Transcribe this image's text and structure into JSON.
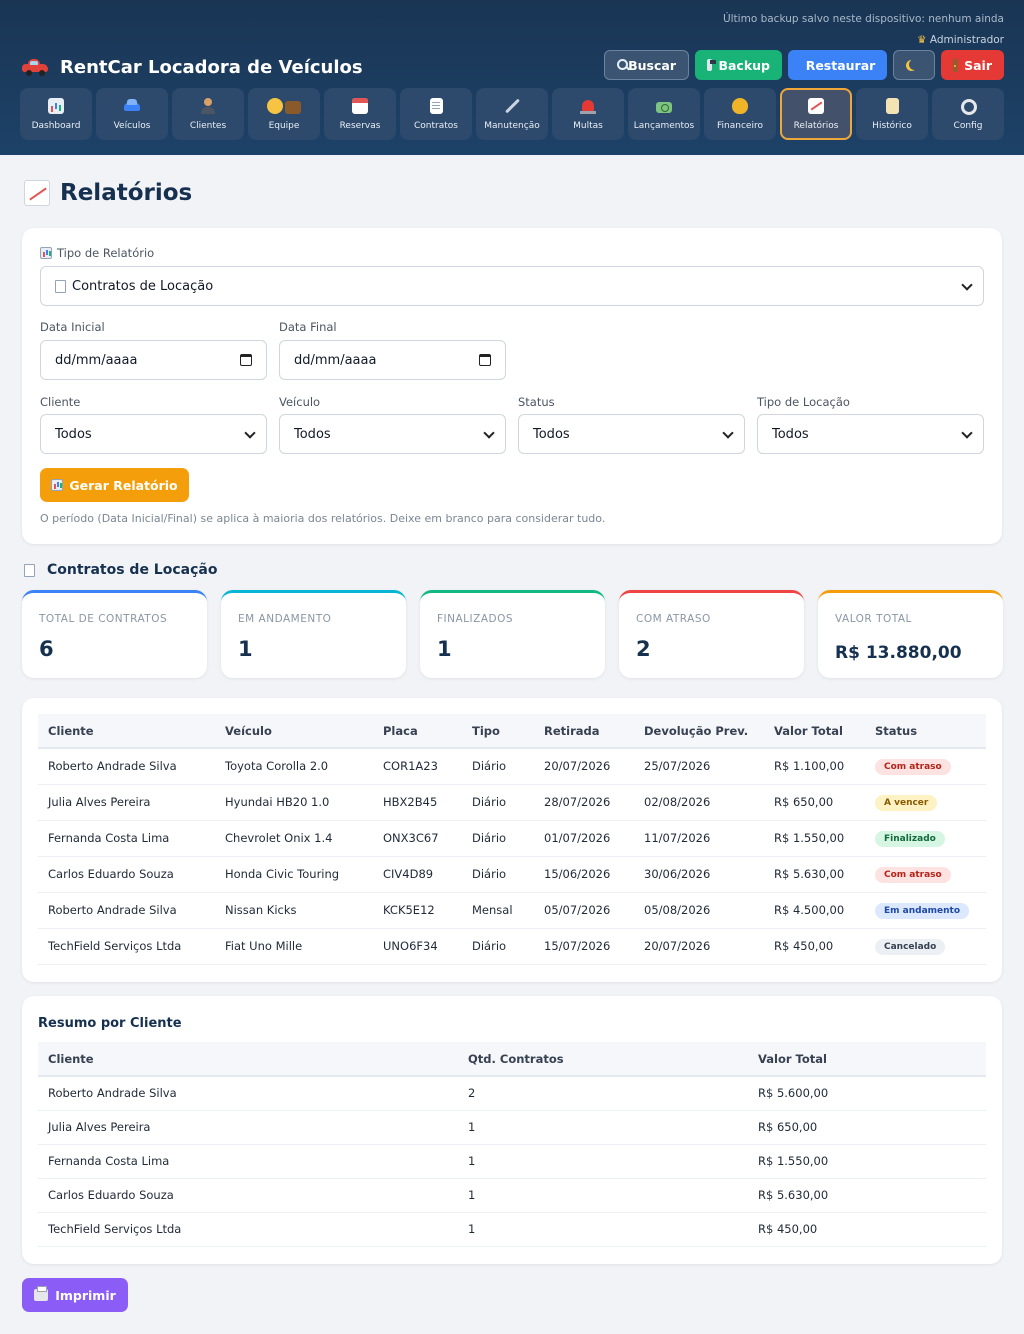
{
  "header": {
    "backup_note": "Último backup salvo neste dispositivo: nenhum ainda",
    "admin_label": "Administrador",
    "app_title": "RentCar Locadora de Veículos",
    "actions": {
      "buscar": "Buscar",
      "backup": "Backup",
      "restaurar": "Restaurar",
      "sair": "Sair"
    },
    "nav": [
      {
        "label": "Dashboard",
        "icon": "bar-chart-icon"
      },
      {
        "label": "Veículos",
        "icon": "car-icon"
      },
      {
        "label": "Clientes",
        "icon": "person-icon"
      },
      {
        "label": "Equipe",
        "icon": "team-icon"
      },
      {
        "label": "Reservas",
        "icon": "calendar-icon"
      },
      {
        "label": "Contratos",
        "icon": "document-icon"
      },
      {
        "label": "Manutenção",
        "icon": "wrench-icon"
      },
      {
        "label": "Multas",
        "icon": "siren-icon"
      },
      {
        "label": "Lançamentos",
        "icon": "money-icon"
      },
      {
        "label": "Financeiro",
        "icon": "money-bag-icon"
      },
      {
        "label": "Relatórios",
        "icon": "trend-chart-icon",
        "active": true
      },
      {
        "label": "Histórico",
        "icon": "scroll-icon"
      },
      {
        "label": "Config",
        "icon": "gear-icon"
      }
    ]
  },
  "page": {
    "title": "Relatórios"
  },
  "filters": {
    "report_type_label": "Tipo de Relatório",
    "report_type_value": "Contratos de Locação",
    "start_date_label": "Data Inicial",
    "start_date_value": "dd/mm/aaaa",
    "end_date_label": "Data Final",
    "end_date_value": "dd/mm/aaaa",
    "client_label": "Cliente",
    "client_value": "Todos",
    "vehicle_label": "Veículo",
    "vehicle_value": "Todos",
    "status_label": "Status",
    "status_value": "Todos",
    "rental_type_label": "Tipo de Locação",
    "rental_type_value": "Todos",
    "generate_label": "Gerar Relatório",
    "hint": "O período (Data Inicial/Final) se aplica à maioria dos relatórios. Deixe em branco para considerar tudo."
  },
  "report": {
    "section_title": "Contratos de Locação",
    "stats": [
      {
        "label": "TOTAL DE CONTRATOS",
        "value": "6",
        "color": "#3b82f6"
      },
      {
        "label": "EM ANDAMENTO",
        "value": "1",
        "color": "#06b6d4"
      },
      {
        "label": "FINALIZADOS",
        "value": "1",
        "color": "#10b981"
      },
      {
        "label": "COM ATRASO",
        "value": "2",
        "color": "#ef4444"
      },
      {
        "label": "VALOR TOTAL",
        "value": "R$ 13.880,00",
        "color": "#f59e0b"
      }
    ],
    "columns": [
      "Cliente",
      "Veículo",
      "Placa",
      "Tipo",
      "Retirada",
      "Devolução Prev.",
      "Valor Total",
      "Status"
    ],
    "rows": [
      {
        "cliente": "Roberto Andrade Silva",
        "veiculo": "Toyota Corolla 2.0",
        "placa": "COR1A23",
        "tipo": "Diário",
        "retirada": "20/07/2026",
        "devolucao": "25/07/2026",
        "valor": "R$ 1.100,00",
        "status": "Com atraso",
        "status_bg": "#fde2e2",
        "status_fg": "#b42318"
      },
      {
        "cliente": "Julia Alves Pereira",
        "veiculo": "Hyundai HB20 1.0",
        "placa": "HBX2B45",
        "tipo": "Diário",
        "retirada": "28/07/2026",
        "devolucao": "02/08/2026",
        "valor": "R$ 650,00",
        "status": "A vencer",
        "status_bg": "#fdf2c4",
        "status_fg": "#8a5a00"
      },
      {
        "cliente": "Fernanda Costa Lima",
        "veiculo": "Chevrolet Onix 1.4",
        "placa": "ONX3C67",
        "tipo": "Diário",
        "retirada": "01/07/2026",
        "devolucao": "11/07/2026",
        "valor": "R$ 1.550,00",
        "status": "Finalizado",
        "status_bg": "#d7f5e3",
        "status_fg": "#116b3d"
      },
      {
        "cliente": "Carlos Eduardo Souza",
        "veiculo": "Honda Civic Touring",
        "placa": "CIV4D89",
        "tipo": "Diário",
        "retirada": "15/06/2026",
        "devolucao": "30/06/2026",
        "valor": "R$ 5.630,00",
        "status": "Com atraso",
        "status_bg": "#fde2e2",
        "status_fg": "#b42318"
      },
      {
        "cliente": "Roberto Andrade Silva",
        "veiculo": "Nissan Kicks",
        "placa": "KCK5E12",
        "tipo": "Mensal",
        "retirada": "05/07/2026",
        "devolucao": "05/08/2026",
        "valor": "R$ 4.500,00",
        "status": "Em andamento",
        "status_bg": "#dbe8fd",
        "status_fg": "#1e49a8"
      },
      {
        "cliente": "TechField Serviços Ltda",
        "veiculo": "Fiat Uno Mille",
        "placa": "UNO6F34",
        "tipo": "Diário",
        "retirada": "15/07/2026",
        "devolucao": "20/07/2026",
        "valor": "R$ 450,00",
        "status": "Cancelado",
        "status_bg": "#eceff3",
        "status_fg": "#374151"
      }
    ]
  },
  "summary": {
    "title": "Resumo por Cliente",
    "columns": [
      "Cliente",
      "Qtd. Contratos",
      "Valor Total"
    ],
    "rows": [
      {
        "cliente": "Roberto Andrade Silva",
        "qtd": "2",
        "valor": "R$ 5.600,00"
      },
      {
        "cliente": "Julia Alves Pereira",
        "qtd": "1",
        "valor": "R$ 650,00"
      },
      {
        "cliente": "Fernanda Costa Lima",
        "qtd": "1",
        "valor": "R$ 1.550,00"
      },
      {
        "cliente": "Carlos Eduardo Souza",
        "qtd": "1",
        "valor": "R$ 5.630,00"
      },
      {
        "cliente": "TechField Serviços Ltda",
        "qtd": "1",
        "valor": "R$ 450,00"
      }
    ]
  },
  "print_label": "Imprimir"
}
